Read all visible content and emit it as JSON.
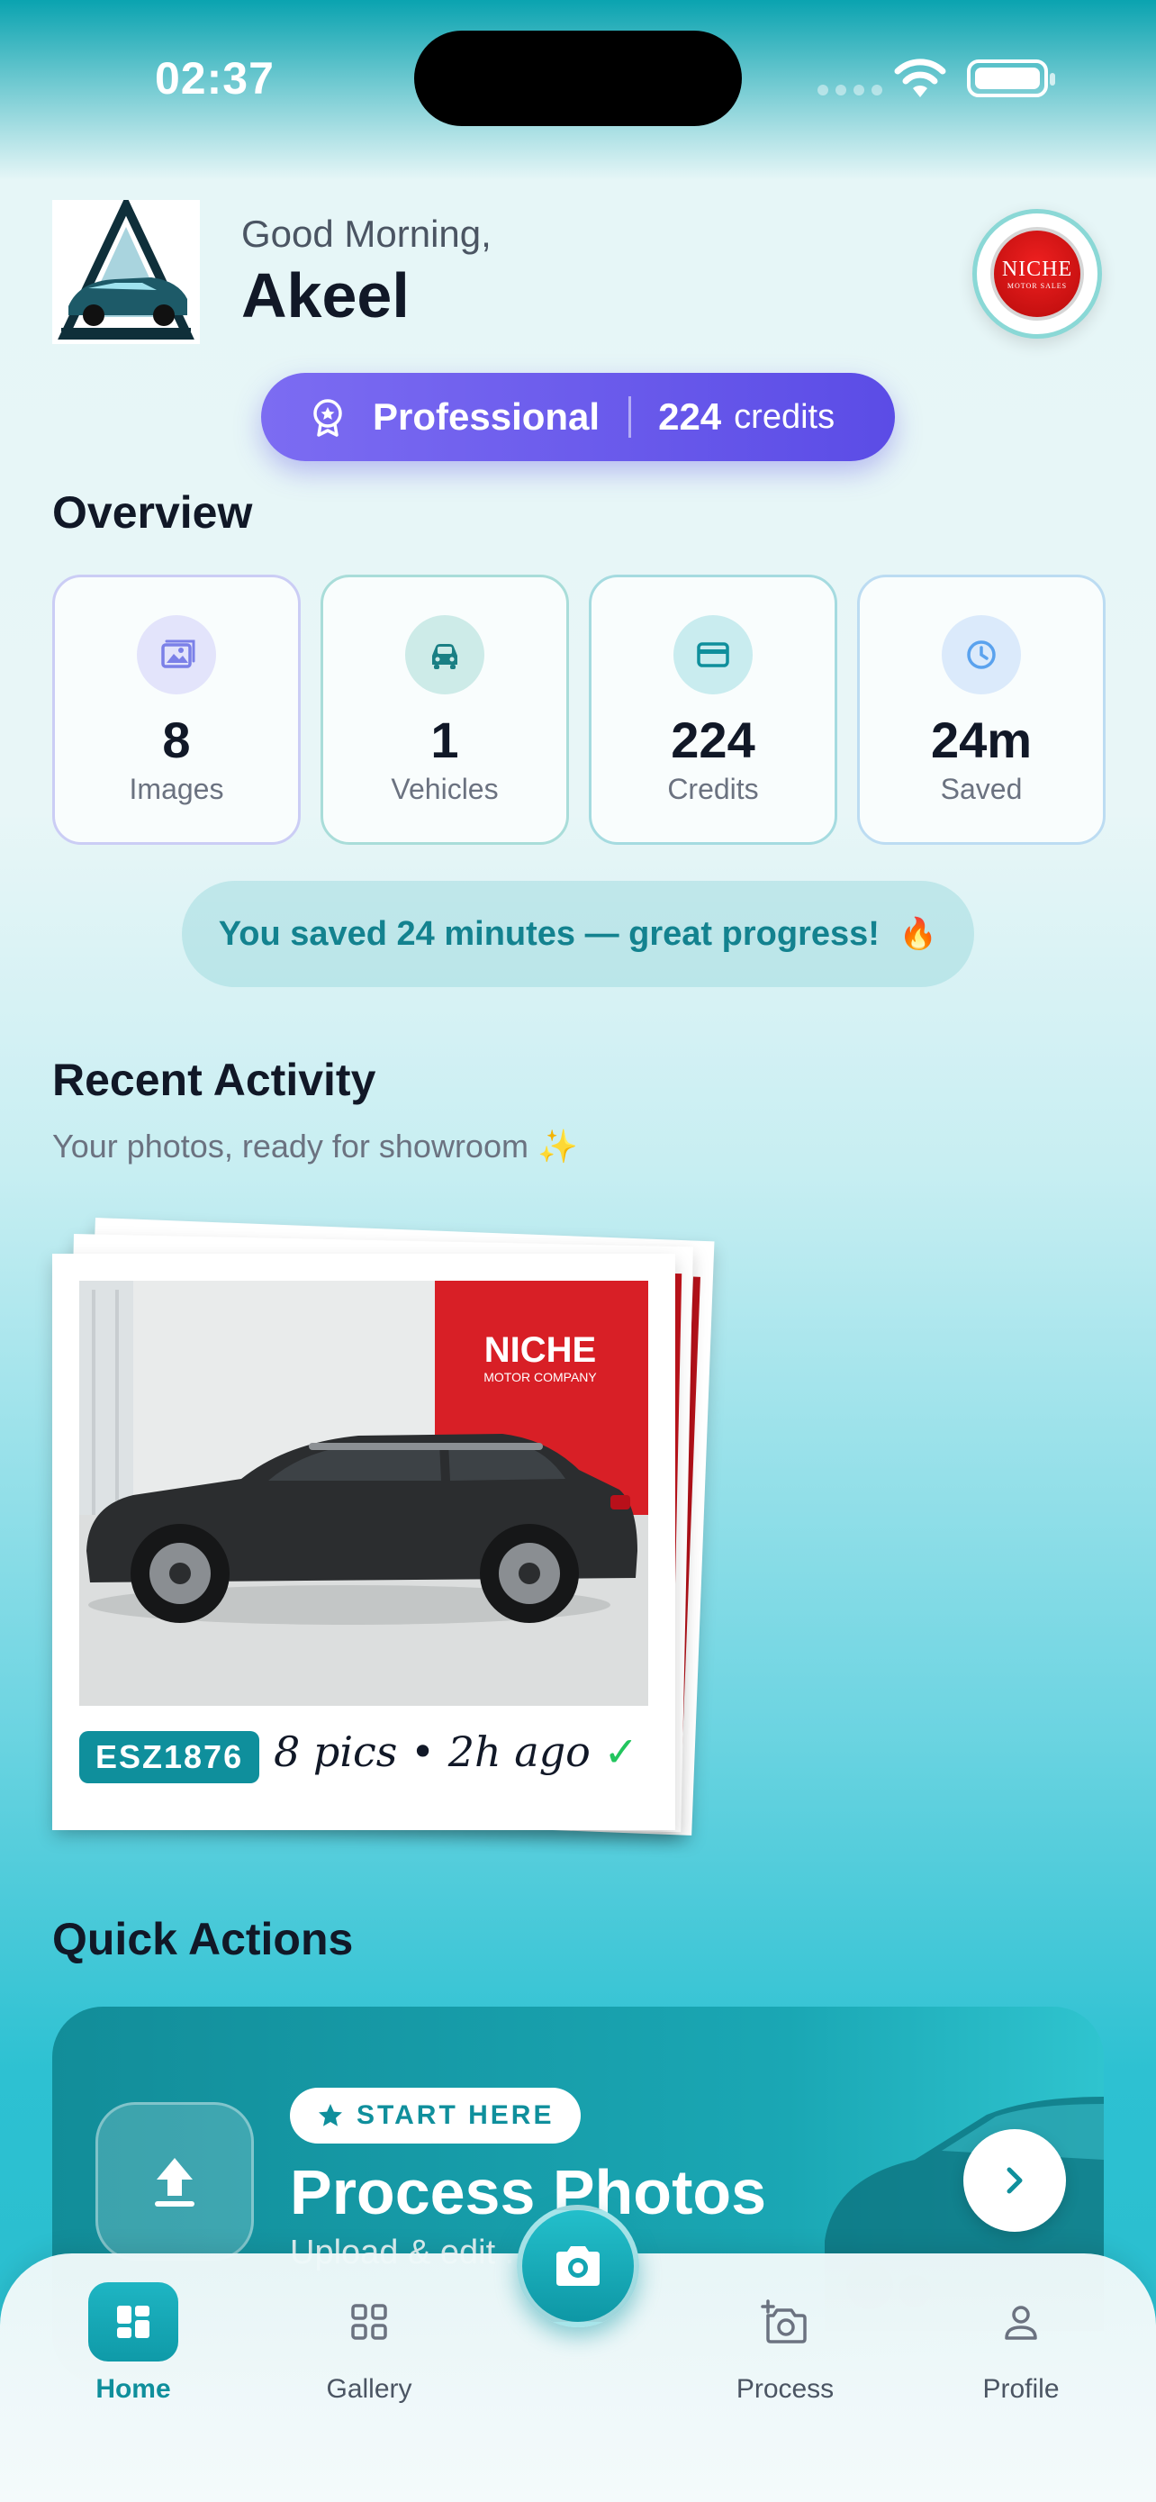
{
  "status_bar": {
    "time": "02:37"
  },
  "header": {
    "greeting": "Good Morning,",
    "user_name": "Akeel",
    "brand_logo_text": "NICHE",
    "brand_logo_subtext": "MOTOR SALES"
  },
  "plan": {
    "name": "Professional",
    "credits_value": "224",
    "credits_label": "credits"
  },
  "overview": {
    "title": "Overview",
    "stats": [
      {
        "value": "8",
        "label": "Images",
        "icon": "images-icon",
        "color": "#8b8ff0"
      },
      {
        "value": "1",
        "label": "Vehicles",
        "icon": "car-icon",
        "color": "#15989f"
      },
      {
        "value": "224",
        "label": "Credits",
        "icon": "credit-card-icon",
        "color": "#1199a6"
      },
      {
        "value": "24m",
        "label": "Saved",
        "icon": "clock-icon",
        "color": "#60a5fa"
      }
    ],
    "saved_message": "You saved 24 minutes — great progress!",
    "saved_emoji": "🔥"
  },
  "recent_activity": {
    "title": "Recent Activity",
    "subtitle": "Your photos, ready for showroom ✨",
    "items": [
      {
        "plate": "ESZ1876",
        "meta": "8 pics • 2h ago",
        "dealer_sign": "NICHE",
        "dealer_sign_sub": "MOTOR COMPANY"
      }
    ]
  },
  "quick_actions": {
    "title": "Quick Actions",
    "card": {
      "chip": "START HERE",
      "title": "Process Photos",
      "description": "Upload & edit ... tos"
    }
  },
  "tabbar": {
    "items": [
      {
        "label": "Home",
        "icon": "grid-icon",
        "active": true
      },
      {
        "label": "Gallery",
        "icon": "gallery-grid-icon",
        "active": false
      },
      {
        "label": "Process",
        "icon": "camera-plus-icon",
        "active": false
      },
      {
        "label": "Profile",
        "icon": "person-icon",
        "active": false
      }
    ],
    "fab_icon": "camera-icon"
  },
  "colors": {
    "accent": "#0f9aa8",
    "plan_gradient_start": "#7c6cf2",
    "plan_gradient_end": "#5b4ce6",
    "dealer_red": "#d81f26"
  }
}
